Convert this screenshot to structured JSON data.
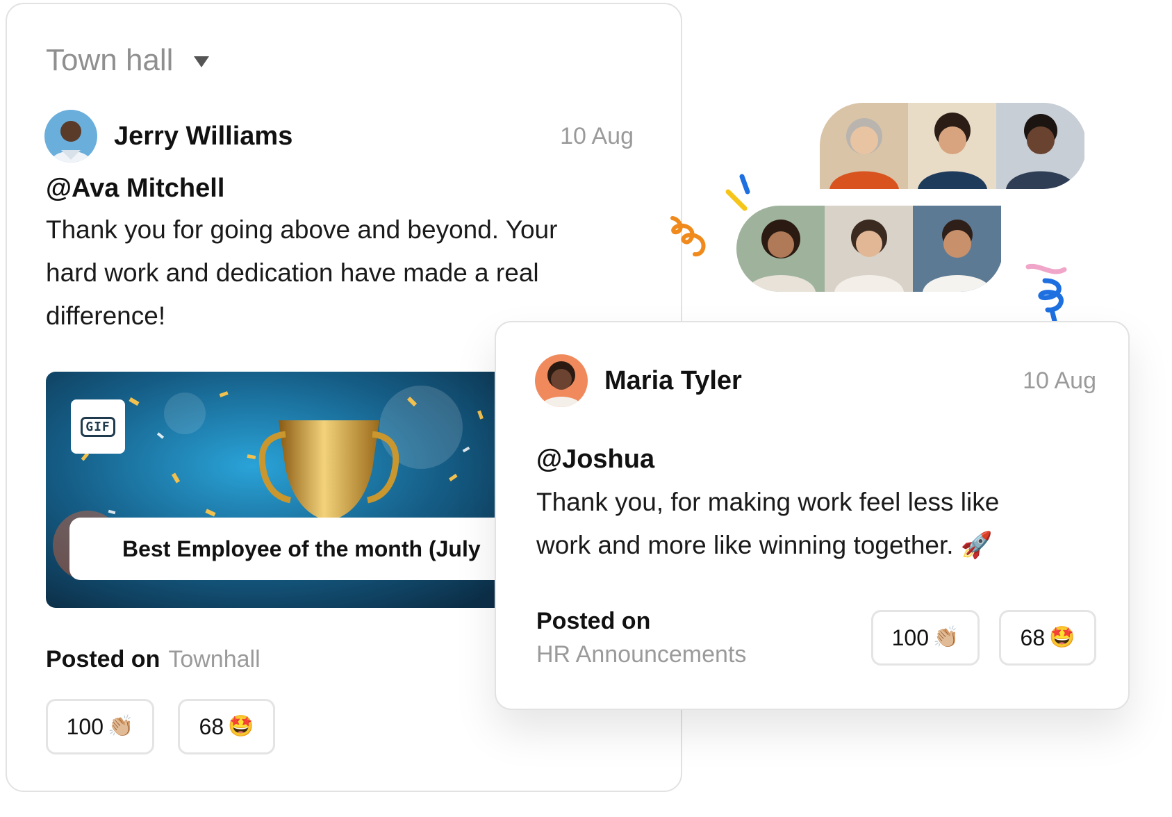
{
  "channel": {
    "title": "Town hall"
  },
  "post_main": {
    "author": "Jerry Williams",
    "date": "10 Aug",
    "mention": "@Ava Mitchell",
    "message_lines": [
      "Thank you for going above and beyond. Your",
      "hard work and dedication have made a real",
      "difference!"
    ],
    "gif_badge": "GIF",
    "gif_caption": "Best Employee of the month (July",
    "posted_label": "Posted on",
    "posted_channel": "Townhall",
    "reactions": [
      {
        "count": "100",
        "emoji": "👏🏼",
        "icon": "clap-icon"
      },
      {
        "count": "68",
        "emoji": "🤩",
        "icon": "star-struck-icon"
      }
    ]
  },
  "post_second": {
    "author": "Maria Tyler",
    "date": "10 Aug",
    "mention": "@Joshua",
    "message_lines": [
      "Thank you, for making work feel less like",
      "work and more like winning together. 🚀"
    ],
    "posted_label": "Posted on",
    "posted_channel": "HR Announcements",
    "reactions": [
      {
        "count": "100",
        "emoji": "👏🏼",
        "icon": "clap-icon"
      },
      {
        "count": "68",
        "emoji": "🤩",
        "icon": "star-struck-icon"
      }
    ]
  },
  "colors": {
    "muted_text": "#8f8f8f",
    "card_border": "#e2e2e2",
    "confetti_orange": "#f08a1c",
    "confetti_blue": "#1e6fe0",
    "confetti_yellow": "#f5c51a",
    "confetti_pink": "#f0a6c8"
  }
}
